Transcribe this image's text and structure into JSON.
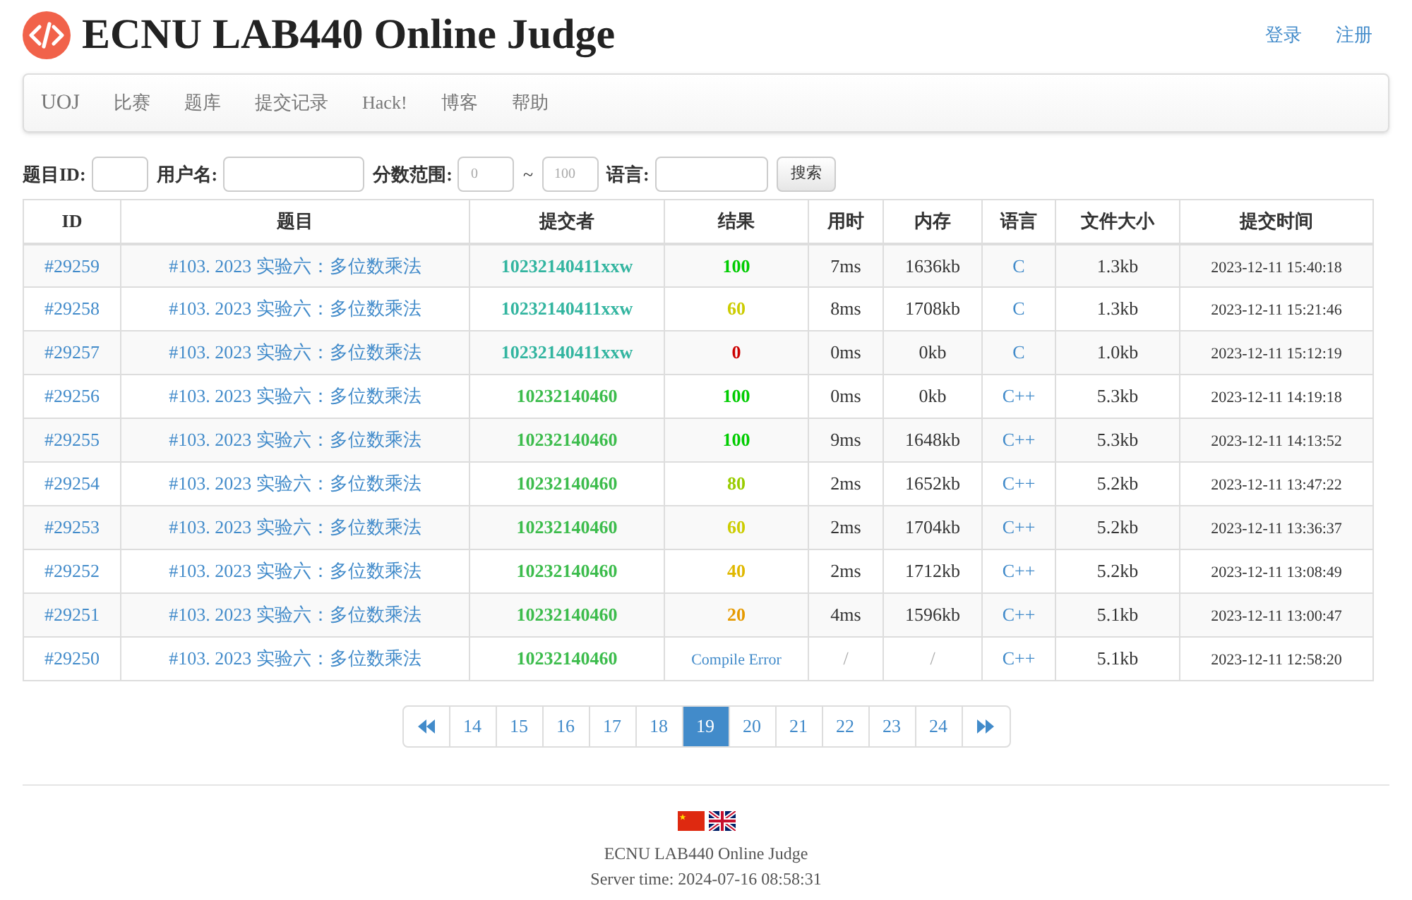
{
  "site_title": "ECNU LAB440 Online Judge",
  "user_links": [
    "登录",
    "注册"
  ],
  "nav": {
    "brand": "UOJ",
    "items": [
      "比赛",
      "题库",
      "提交记录",
      "Hack!",
      "博客",
      "帮助"
    ]
  },
  "search": {
    "fields": [
      {
        "label": "题目ID:"
      },
      {
        "label": "用户名:"
      },
      {
        "label": "分数范围:",
        "placeholder": "0"
      },
      {
        "label": "~",
        "placeholder": "100"
      },
      {
        "label": "语言:"
      }
    ],
    "button": "搜索"
  },
  "table": {
    "columns": [
      "ID",
      "题目",
      "提交者",
      "结果",
      "用时",
      "内存",
      "语言",
      "文件大小",
      "提交时间"
    ],
    "rows": [
      {
        "id": "#29259",
        "problem": "#103. 2023 实验六：多位数乘法",
        "submitter": {
          "text": "10232140411xxw",
          "color": "#33b5a0"
        },
        "result": {
          "text": "100",
          "color": "#00cc00",
          "kind": "score"
        },
        "time": "7ms",
        "memory": "1636kb",
        "language": "C",
        "size": "1.3kb",
        "submit_time": "2023-12-11 15:40:18"
      },
      {
        "id": "#29258",
        "problem": "#103. 2023 实验六：多位数乘法",
        "submitter": {
          "text": "10232140411xxw",
          "color": "#33b5a0"
        },
        "result": {
          "text": "60",
          "color": "#cccc00",
          "kind": "score"
        },
        "time": "8ms",
        "memory": "1708kb",
        "language": "C",
        "size": "1.3kb",
        "submit_time": "2023-12-11 15:21:46"
      },
      {
        "id": "#29257",
        "problem": "#103. 2023 实验六：多位数乘法",
        "submitter": {
          "text": "10232140411xxw",
          "color": "#33b5a0"
        },
        "result": {
          "text": "0",
          "color": "#cc0000",
          "kind": "score"
        },
        "time": "0ms",
        "memory": "0kb",
        "language": "C",
        "size": "1.0kb",
        "submit_time": "2023-12-11 15:12:19"
      },
      {
        "id": "#29256",
        "problem": "#103. 2023 实验六：多位数乘法",
        "submitter": {
          "text": "10232140460",
          "color": "#3cbc4c"
        },
        "result": {
          "text": "100",
          "color": "#00cc00",
          "kind": "score"
        },
        "time": "0ms",
        "memory": "0kb",
        "language": "C++",
        "size": "5.3kb",
        "submit_time": "2023-12-11 14:19:18"
      },
      {
        "id": "#29255",
        "problem": "#103. 2023 实验六：多位数乘法",
        "submitter": {
          "text": "10232140460",
          "color": "#3cbc4c"
        },
        "result": {
          "text": "100",
          "color": "#00cc00",
          "kind": "score"
        },
        "time": "9ms",
        "memory": "1648kb",
        "language": "C++",
        "size": "5.3kb",
        "submit_time": "2023-12-11 14:13:52"
      },
      {
        "id": "#29254",
        "problem": "#103. 2023 实验六：多位数乘法",
        "submitter": {
          "text": "10232140460",
          "color": "#3cbc4c"
        },
        "result": {
          "text": "80",
          "color": "#99cc00",
          "kind": "score"
        },
        "time": "2ms",
        "memory": "1652kb",
        "language": "C++",
        "size": "5.2kb",
        "submit_time": "2023-12-11 13:47:22"
      },
      {
        "id": "#29253",
        "problem": "#103. 2023 实验六：多位数乘法",
        "submitter": {
          "text": "10232140460",
          "color": "#3cbc4c"
        },
        "result": {
          "text": "60",
          "color": "#cccc00",
          "kind": "score"
        },
        "time": "2ms",
        "memory": "1704kb",
        "language": "C++",
        "size": "5.2kb",
        "submit_time": "2023-12-11 13:36:37"
      },
      {
        "id": "#29252",
        "problem": "#103. 2023 实验六：多位数乘法",
        "submitter": {
          "text": "10232140460",
          "color": "#3cbc4c"
        },
        "result": {
          "text": "40",
          "color": "#e0b800",
          "kind": "score"
        },
        "time": "2ms",
        "memory": "1712kb",
        "language": "C++",
        "size": "5.2kb",
        "submit_time": "2023-12-11 13:08:49"
      },
      {
        "id": "#29251",
        "problem": "#103. 2023 实验六：多位数乘法",
        "submitter": {
          "text": "10232140460",
          "color": "#3cbc4c"
        },
        "result": {
          "text": "20",
          "color": "#e69a00",
          "kind": "score"
        },
        "time": "4ms",
        "memory": "1596kb",
        "language": "C++",
        "size": "5.1kb",
        "submit_time": "2023-12-11 13:00:47"
      },
      {
        "id": "#29250",
        "problem": "#103. 2023 实验六：多位数乘法",
        "submitter": {
          "text": "10232140460",
          "color": "#3cbc4c"
        },
        "result": {
          "text": "Compile Error",
          "color": "#428bca",
          "kind": "status"
        },
        "time": "/",
        "memory": "/",
        "language": "C++",
        "size": "5.1kb",
        "submit_time": "2023-12-11 12:58:20"
      }
    ]
  },
  "pagination": [
    {
      "label": "14",
      "selected": false
    },
    {
      "label": "15",
      "selected": false
    },
    {
      "label": "16",
      "selected": false
    },
    {
      "label": "17",
      "selected": false
    },
    {
      "label": "18",
      "selected": false
    },
    {
      "label": "19",
      "selected": true
    },
    {
      "label": "20",
      "selected": false
    },
    {
      "label": "21",
      "selected": false
    },
    {
      "label": "22",
      "selected": false
    },
    {
      "label": "23",
      "selected": false
    },
    {
      "label": "24",
      "selected": false
    }
  ],
  "footer": {
    "name": "ECNU LAB440 Online Judge",
    "server_time": "Server time: 2024-07-16 08:58:31"
  }
}
